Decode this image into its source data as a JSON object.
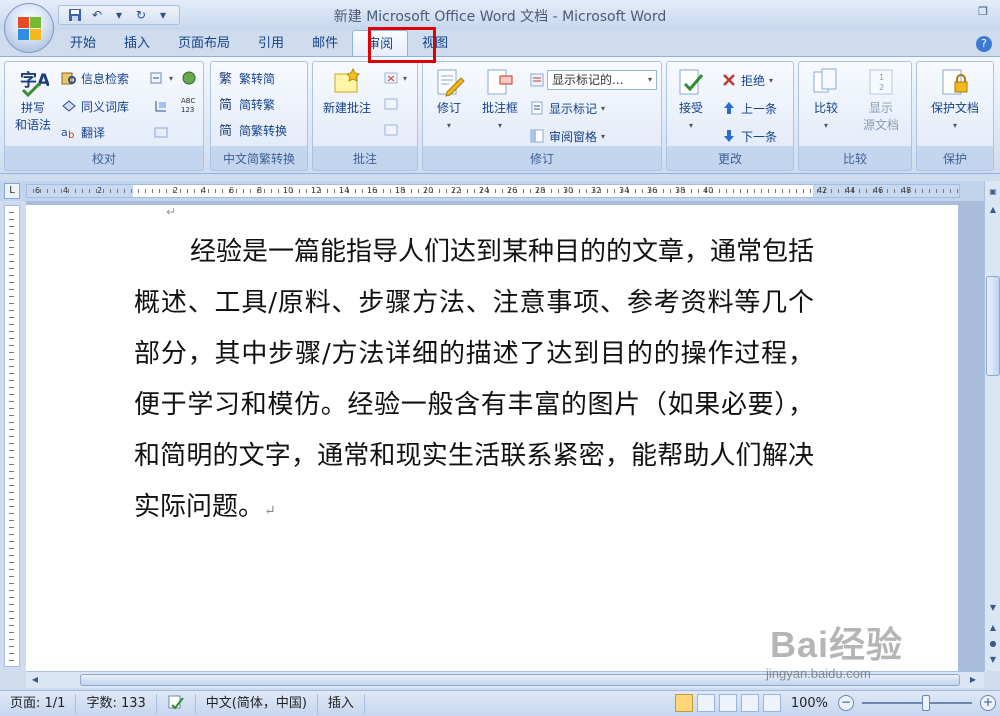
{
  "window": {
    "title": "新建 Microsoft Office Word 文档 - Microsoft Word"
  },
  "quick_access": [
    "save-icon",
    "undo-icon",
    "redo-icon",
    "customize-icon"
  ],
  "tabs": [
    {
      "label": "开始"
    },
    {
      "label": "插入"
    },
    {
      "label": "页面布局"
    },
    {
      "label": "引用"
    },
    {
      "label": "邮件"
    },
    {
      "label": "审阅",
      "active": true
    },
    {
      "label": "视图"
    }
  ],
  "ribbon": {
    "proofing": {
      "label": "校对",
      "spell_check": "拼写\n和语法",
      "spell_check_l1": "拼写",
      "spell_check_l2": "和语法",
      "research": "信息检索",
      "thesaurus": "同义词库",
      "translate": "翻译"
    },
    "chinese_conversion": {
      "label": "中文简繁转换",
      "to_traditional": "繁转简",
      "to_simplified": "简转繁",
      "convert": "简繁转换"
    },
    "comments": {
      "label": "批注",
      "new_comment": "新建批注"
    },
    "tracking": {
      "label": "修订",
      "track_changes": "修订",
      "balloons": "批注框",
      "display_combo": "显示标记的...",
      "show_markup": "显示标记",
      "reviewing_pane": "审阅窗格"
    },
    "changes": {
      "label": "更改",
      "accept": "接受",
      "reject": "拒绝",
      "previous": "上一条",
      "next": "下一条"
    },
    "compare": {
      "label": "比较",
      "compare": "比较",
      "show_source_l1": "显示",
      "show_source_l2": "源文档"
    },
    "protect": {
      "label": "保护",
      "protect_doc": "保护文档"
    }
  },
  "ruler": {
    "numbers": [
      "6",
      "4",
      "2",
      "2",
      "4",
      "6",
      "8",
      "10",
      "12",
      "14",
      "16",
      "18",
      "20",
      "22",
      "24",
      "26",
      "28",
      "30",
      "32",
      "34",
      "36",
      "38",
      "40",
      "42",
      "44",
      "46",
      "48"
    ]
  },
  "document": {
    "paragraph": "经验是一篇能指导人们达到某种目的的文章，通常包括概述、工具/原料、步骤方法、注意事项、参考资料等几个部分，其中步骤/方法详细的描述了达到目的的操作过程，便于学习和模仿。经验一般含有丰富的图片（如果必要），和简明的文字，通常和现实生活联系紧密，能帮助人们解决实际问题。"
  },
  "statusbar": {
    "page": "页面: 1/1",
    "word_count": "字数: 133",
    "language": "中文(简体，中国)",
    "insert_mode": "插入",
    "zoom": "100%"
  },
  "watermark": {
    "brand": "Bai经验",
    "url": "jingyan.baidu.com"
  },
  "colors": {
    "highlight_box": "#e00000",
    "ribbon_text": "#15428b"
  }
}
